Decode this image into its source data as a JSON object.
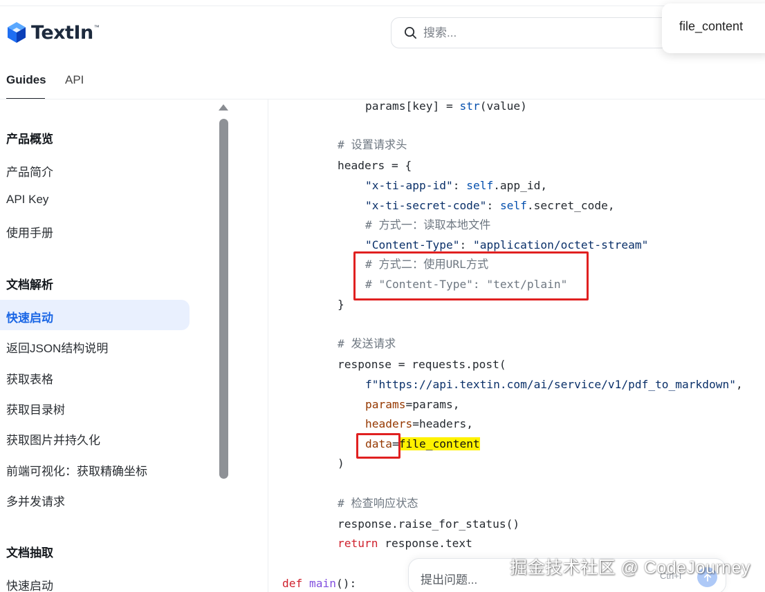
{
  "header": {
    "logo_text": "TextIn",
    "logo_tm": "™",
    "search_placeholder": "搜索...",
    "tooltip": "file_content"
  },
  "tabs": [
    {
      "label": "Guides",
      "active": true
    },
    {
      "label": "API",
      "active": false
    }
  ],
  "sidebar": {
    "sections": [
      {
        "title": "产品概览",
        "items": [
          "产品简介",
          "API Key",
          "使用手册"
        ]
      },
      {
        "title": "文档解析",
        "items": [
          "快速启动",
          "返回JSON结构说明",
          "获取表格",
          "获取目录树",
          "获取图片并持久化",
          "前端可视化：获取精确坐标",
          "多并发请求"
        ]
      },
      {
        "title": "文档抽取",
        "items": [
          "快速启动"
        ]
      }
    ],
    "active_item": "快速启动"
  },
  "code": {
    "l1": {
      "a": "params[key] = ",
      "b": "str",
      "c": "(value)"
    },
    "l2": "# 设置请求头",
    "l3": "headers = {",
    "l4": {
      "a": "\"x-ti-app-id\"",
      "b": ": ",
      "c": "self",
      "d": ".app_id,"
    },
    "l5": {
      "a": "\"x-ti-secret-code\"",
      "b": ": ",
      "c": "self",
      "d": ".secret_code,"
    },
    "l6": "# 方式一：读取本地文件",
    "l7": {
      "a": "\"Content-Type\"",
      "b": ": ",
      "c": "\"application/octet-stream\""
    },
    "l8": "# 方式二：使用URL方式",
    "l9": "# \"Content-Type\": \"text/plain\"",
    "l10": "}",
    "l11": "# 发送请求",
    "l12": "response = requests.post(",
    "l13": {
      "a": "f\"https://api.textin.com/ai/service/v1/pdf_to_markdown\"",
      "b": ","
    },
    "l14": {
      "a": "params",
      "b": "=params,"
    },
    "l15": {
      "a": "headers",
      "b": "=headers,"
    },
    "l16": {
      "a": "data",
      "b": "=",
      "c": "file_content"
    },
    "l17": ")",
    "l18": "# 检查响应状态",
    "l19": "response.raise_for_status()",
    "l20": {
      "a": "return",
      "b": " response.text"
    },
    "l21": {
      "a": "def",
      "b": " ",
      "c": "main",
      "d": "():"
    }
  },
  "ask": {
    "placeholder": "提出问题...",
    "shortcut": "Ctrl+I"
  },
  "watermark": "掘金技术社区 @ CodeJourney",
  "colors": {
    "accent": "#1a66e5",
    "active_bg": "#e9f0fe",
    "annotation_red": "#e02020",
    "highlight": "#fff200"
  }
}
